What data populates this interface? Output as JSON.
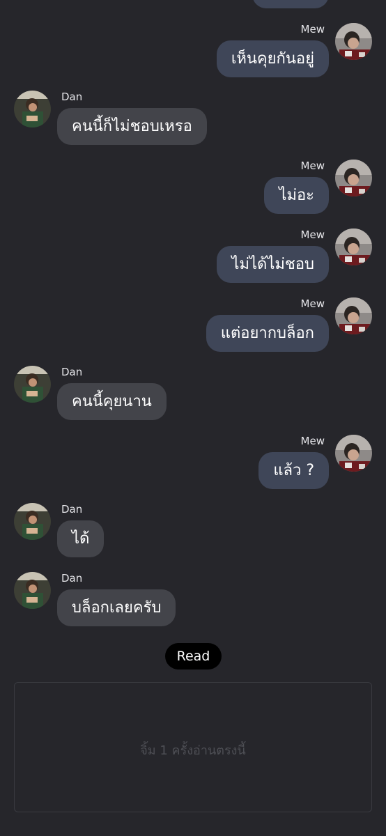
{
  "messages": [
    {
      "sender": "Mew",
      "text": "เห็นคุยกันอยู่"
    },
    {
      "sender": "Dan",
      "text": "คนนี้ก็ไม่ชอบเหรอ"
    },
    {
      "sender": "Mew",
      "text": "ไม่อะ"
    },
    {
      "sender": "Mew",
      "text": "ไม่ได้ไม่ชอบ"
    },
    {
      "sender": "Mew",
      "text": "แต่อยากบล็อก"
    },
    {
      "sender": "Dan",
      "text": "คนนี้คุยนาน"
    },
    {
      "sender": "Mew",
      "text": "แล้ว ?"
    },
    {
      "sender": "Dan",
      "text": "ได้"
    },
    {
      "sender": "Dan",
      "text": "บล็อกเลยครับ"
    }
  ],
  "read_label": "Read",
  "input": {
    "placeholder": "จิ้ม 1 ครั้งอ่านตรงนี้"
  },
  "colors": {
    "background": "#26262b",
    "my_bubble": "#3f4658",
    "their_bubble": "#43444a",
    "read_pill": "#000000"
  }
}
